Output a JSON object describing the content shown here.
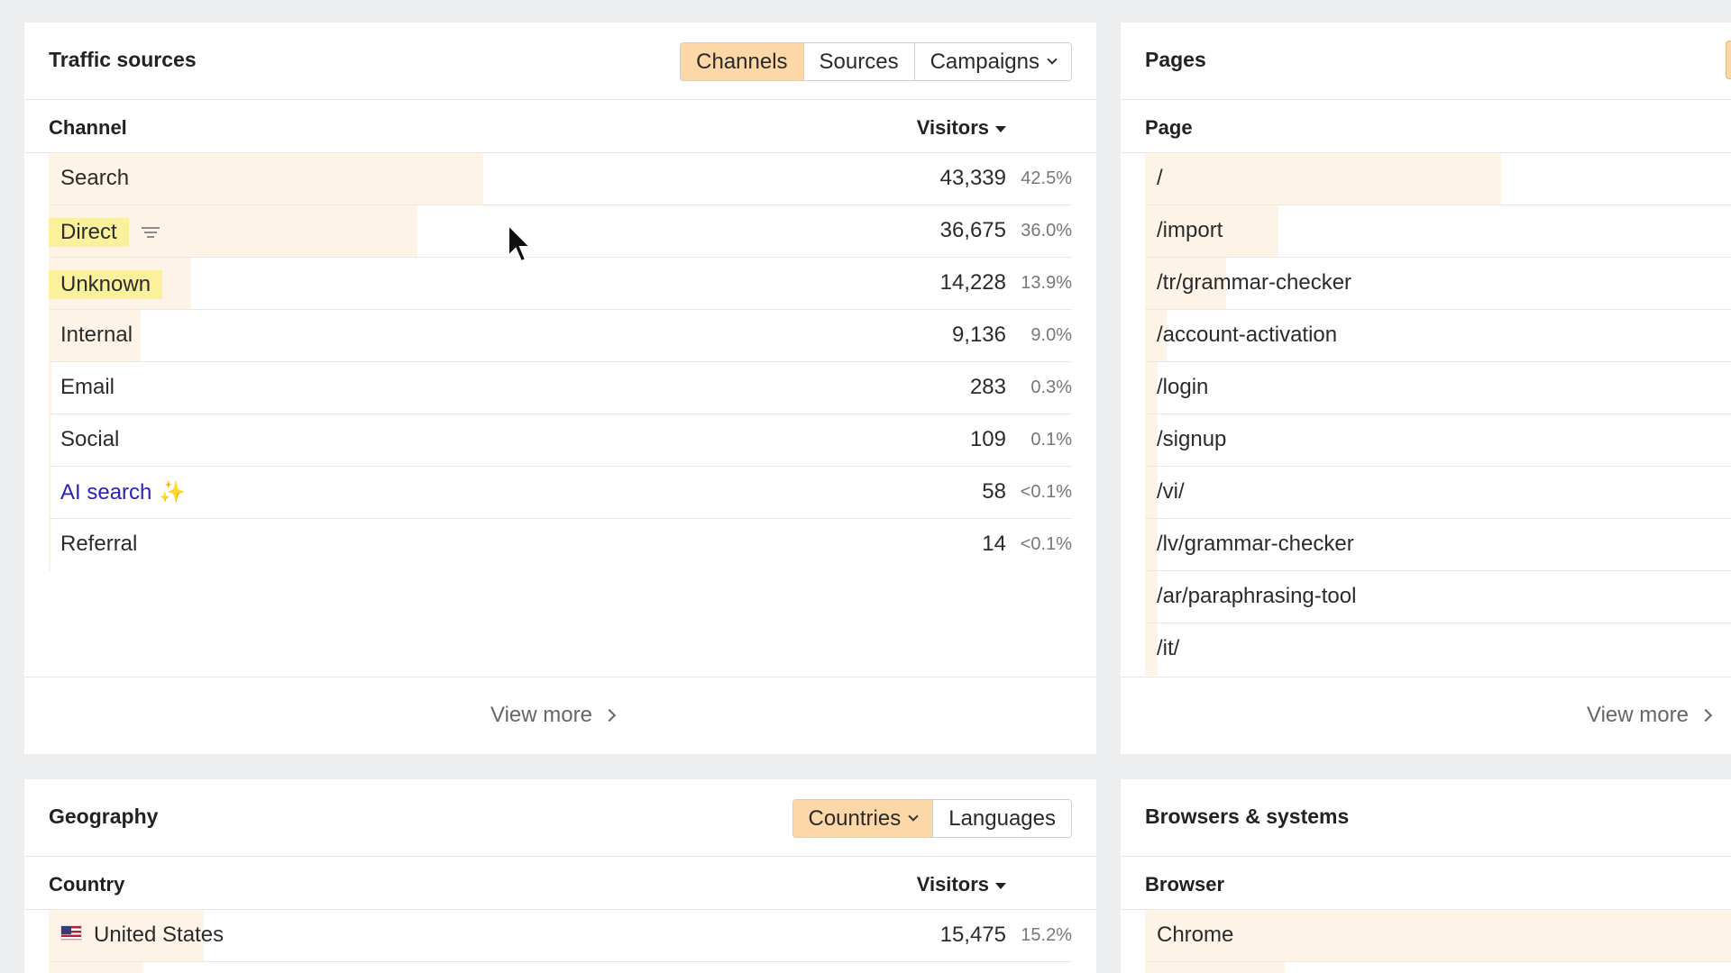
{
  "traffic": {
    "title": "Traffic sources",
    "tabs": [
      {
        "label": "Channels",
        "active": true
      },
      {
        "label": "Sources",
        "active": false
      },
      {
        "label": "Campaigns",
        "active": false
      }
    ],
    "col_label": "Channel",
    "col_right": "Visitors",
    "rows": [
      {
        "name": "Search",
        "visitors": "43,339",
        "pct": "42.5%",
        "share": 0.425
      },
      {
        "name": "Direct",
        "visitors": "36,675",
        "pct": "36.0%",
        "share": 0.36
      },
      {
        "name": "Unknown",
        "visitors": "14,228",
        "pct": "13.9%",
        "share": 0.139
      },
      {
        "name": "Internal",
        "visitors": "9,136",
        "pct": "9.0%",
        "share": 0.09
      },
      {
        "name": "Email",
        "visitors": "283",
        "pct": "0.3%",
        "share": 0.003
      },
      {
        "name": "Social",
        "visitors": "109",
        "pct": "0.1%",
        "share": 0.001
      },
      {
        "name": "AI search",
        "visitors": "58",
        "pct": "<0.1%",
        "share": 0.0005
      },
      {
        "name": "Referral",
        "visitors": "14",
        "pct": "<0.1%",
        "share": 0.0001
      }
    ],
    "view_more": "View more"
  },
  "pages": {
    "title": "Pages",
    "col_label": "Page",
    "rows": [
      {
        "name": "/",
        "share": 0.6
      },
      {
        "name": "/import",
        "share": 0.22
      },
      {
        "name": "/tr/grammar-checker",
        "share": 0.135
      },
      {
        "name": "/account-activation",
        "share": 0.035
      },
      {
        "name": "/login",
        "share": 0.02
      },
      {
        "name": "/signup",
        "share": 0.02
      },
      {
        "name": "/vi/",
        "share": 0.02
      },
      {
        "name": "/lv/grammar-checker",
        "share": 0.02
      },
      {
        "name": "/ar/paraphrasing-tool",
        "share": 0.02
      },
      {
        "name": "/it/",
        "share": 0.02
      }
    ],
    "view_more": "View more"
  },
  "geography": {
    "title": "Geography",
    "tabs": [
      {
        "label": "Countries",
        "active": true
      },
      {
        "label": "Languages",
        "active": false
      }
    ],
    "col_label": "Country",
    "col_right": "Visitors",
    "rows": [
      {
        "name": "United States",
        "visitors": "15,475",
        "pct": "15.2%",
        "share": 0.152
      }
    ]
  },
  "browsers": {
    "title": "Browsers & systems",
    "col_label": "Browser",
    "rows": [
      {
        "name": "Chrome",
        "share": 1.0
      }
    ]
  },
  "colors": {
    "accent": "#fcd7a8",
    "bar": "#fdf3e6",
    "highlight": "#fbf09c",
    "ai_text": "#2b22b8",
    "sparkle": "#c026d3"
  },
  "icons": [
    "chevron-down-icon",
    "sort-descending-icon",
    "filter-icon",
    "sparkles-icon",
    "chevron-right-icon",
    "us-flag-icon",
    "mouse-cursor-icon"
  ]
}
